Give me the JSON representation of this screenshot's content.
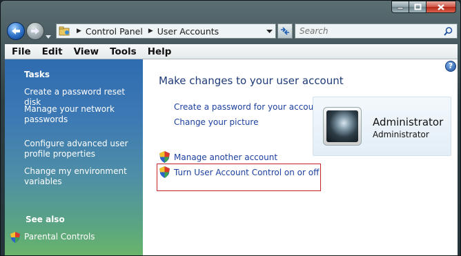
{
  "window": {
    "title": "User Accounts"
  },
  "address_bar": {
    "breadcrumbs": [
      "Control Panel",
      "User Accounts"
    ]
  },
  "search": {
    "placeholder": "Search"
  },
  "menu": [
    "File",
    "Edit",
    "View",
    "Tools",
    "Help"
  ],
  "sidebar": {
    "tasks_heading": "Tasks",
    "tasks": [
      "Create a password reset disk",
      "Manage your network passwords",
      "Configure advanced user profile properties",
      "Change my environment variables"
    ],
    "see_also_heading": "See also",
    "see_also": [
      "Parental Controls"
    ]
  },
  "main": {
    "title": "Make changes to your user account",
    "links": [
      "Create a password for your account",
      "Change your picture"
    ],
    "admin_links": [
      "Manage another account",
      "Turn User Account Control on or off"
    ],
    "highlighted_link": "Turn User Account Control on or off"
  },
  "user": {
    "name": "Administrator",
    "role": "Administrator"
  },
  "colors": {
    "link": "#1c3fa0",
    "title": "#1e3a78",
    "highlight_border": "#c4222a"
  },
  "icons": [
    "back-arrow-icon",
    "forward-arrow-icon",
    "folder-icon",
    "refresh-icon",
    "search-icon",
    "help-icon",
    "uac-shield-icon",
    "minimize-icon",
    "maximize-icon",
    "close-icon"
  ]
}
